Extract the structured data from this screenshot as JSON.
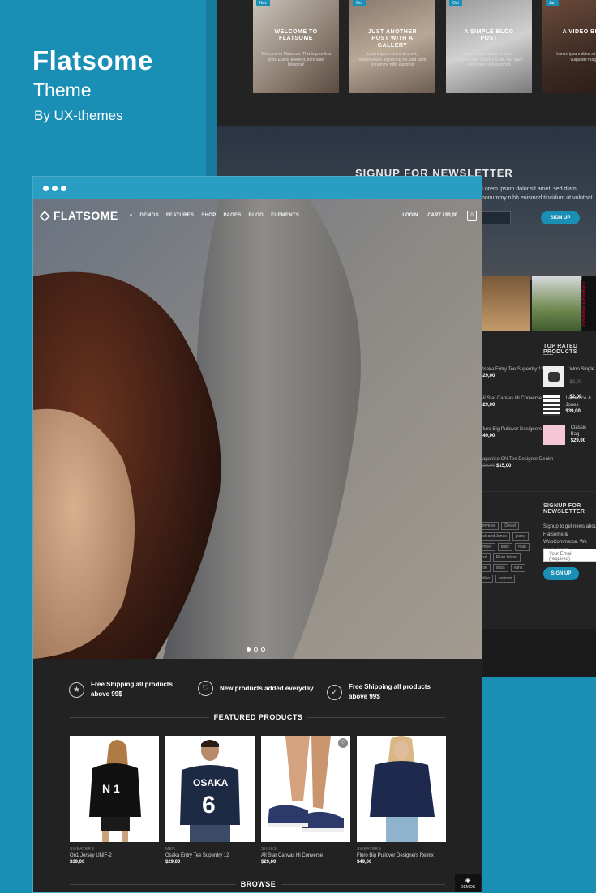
{
  "brand": {
    "title": "Flatsome",
    "subtitle": "Theme",
    "by": "By UX-themes"
  },
  "back": {
    "blog": [
      {
        "badge": "Nov",
        "title": "WELCOME TO FLATSOME",
        "text": "Welcome to Flatsome. This is your first post. Edit or delete it, then start blogging!"
      },
      {
        "badge": "Oct",
        "title": "JUST ANOTHER POST WITH A GALLERY",
        "text": "Lorem ipsum dolor sit amet, consectetuer adipiscing elit, sed diam nonummy nibh euismod"
      },
      {
        "badge": "Oct",
        "title": "A SIMPLE BLOG POST",
        "text": "Lorem ipsum dolor sit amet, consectetuer adipiscing elit, sed diam nonummy nibh euismod"
      },
      {
        "badge": "Jan",
        "title": "A VIDEO BLOG",
        "text": "Lorem ipsum dolor sit amet, sed vulputate magna"
      }
    ],
    "newsletter": {
      "title": "SIGNUP FOR NEWSLETTER",
      "text": "Lorem ipsum dolor sit amet, sed diam nonummy nibh euismod tincidunt ut volutpat.",
      "button": "SIGN UP"
    },
    "insta_label": "Goldmarie Fashion",
    "latest": [
      {
        "name": "Osaka Entry Tee Superdry 12",
        "price": "$29,00"
      },
      {
        "name": "All Star Canvas Hi Converse",
        "price": "$29,00"
      },
      {
        "name": "Fluro Big Pullover Designers Remix",
        "price": "$49,00"
      },
      {
        "name": "Japanise CN Tee Designer Denim",
        "old": "$20,00",
        "price": "$15,00"
      }
    ],
    "top_rated": {
      "title": "TOP RATED PRODUCTS",
      "items": [
        {
          "name": "Woo Single",
          "old": "$3,00",
          "price": "$2,00"
        },
        {
          "name": "Lawrence & Jones",
          "price": "$39,00"
        },
        {
          "name": "Classic Bag",
          "price": "$29,00"
        }
      ]
    },
    "tags": [
      "Converse",
      "Diesel",
      "Jack and Jones",
      "jeans",
      "Jumper",
      "knits",
      "man",
      "nyxd",
      "River Island",
      "shoe",
      "stars",
      "vans",
      "wollen",
      "women"
    ],
    "signup": {
      "title": "SIGNUP FOR NEWSLETTER",
      "text": "Signup to get news about Flatsome & WooCommerce. We never spam.",
      "placeholder": "Your Email (required)",
      "button": "SIGN UP"
    }
  },
  "front": {
    "logo": "FLATSOME",
    "menu": [
      "DEMOS",
      "FEATURES",
      "SHOP",
      "PAGES",
      "BLOG",
      "ELEMENTS"
    ],
    "login": "LOGIN",
    "cart": "CART / $0,00",
    "cart_count": "0",
    "features": [
      {
        "icon": "star-icon",
        "text": "Free Shipping all products above 99$"
      },
      {
        "icon": "heart-icon",
        "text": "New products added everyday"
      },
      {
        "icon": "check-icon",
        "text": "Free Shipping all products above 99$"
      }
    ],
    "featured_title": "FEATURED PRODUCTS",
    "products": [
      {
        "category": "SWEATERS",
        "name": "On1 Jersey UNIF-2",
        "price": "$39,00"
      },
      {
        "category": "MEN",
        "name": "Osaka Entry Tee Superdry 12",
        "price": "$29,00"
      },
      {
        "category": "SHOES",
        "name": "All Star Canvas Hi Converse",
        "price": "$29,00"
      },
      {
        "category": "SWEATERS",
        "name": "Fluro Big Pullover Designers Remix",
        "price": "$49,00"
      }
    ],
    "browse_title": "BROWSE",
    "demos_label": "DEMOS"
  }
}
